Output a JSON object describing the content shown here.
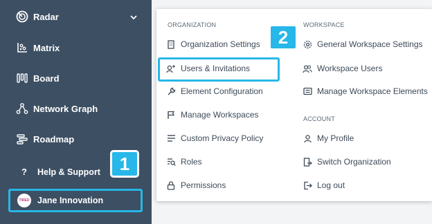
{
  "sidebar": {
    "items": [
      {
        "label": "Radar",
        "icon": "radar-icon"
      },
      {
        "label": "Matrix",
        "icon": "matrix-icon"
      },
      {
        "label": "Board",
        "icon": "board-icon"
      },
      {
        "label": "Network Graph",
        "icon": "network-graph-icon"
      },
      {
        "label": "Roadmap",
        "icon": "roadmap-icon"
      }
    ],
    "help_label": "Help & Support",
    "user_name": "Jane Innovation",
    "avatar_text": "TIRED"
  },
  "badges": {
    "one": "1",
    "two": "2"
  },
  "menu": {
    "organization_heading": "ORGANIZATION",
    "organization_items": [
      {
        "label": "Organization Settings",
        "icon": "building-icon"
      },
      {
        "label": "Users & Invitations",
        "icon": "user-plus-icon"
      },
      {
        "label": "Element Configuration",
        "icon": "wrench-icon"
      },
      {
        "label": "Manage Workspaces",
        "icon": "flag-icon"
      },
      {
        "label": "Custom Privacy Policy",
        "icon": "lines-icon"
      },
      {
        "label": "Roles",
        "icon": "roles-icon"
      },
      {
        "label": "Permissions",
        "icon": "lock-icon"
      }
    ],
    "workspace_heading": "WORKSPACE",
    "workspace_items": [
      {
        "label": "General Workspace Settings",
        "icon": "gear-icon"
      },
      {
        "label": "Workspace Users",
        "icon": "users-icon"
      },
      {
        "label": "Manage Workspace Elements",
        "icon": "list-box-icon"
      }
    ],
    "account_heading": "ACCOUNT",
    "account_items": [
      {
        "label": "My Profile",
        "icon": "user-icon"
      },
      {
        "label": "Switch Organization",
        "icon": "switch-icon"
      },
      {
        "label": "Log out",
        "icon": "logout-icon"
      }
    ]
  },
  "colors": {
    "sidebar": "#3d4f63",
    "accent": "#27b7e8",
    "menu_text": "#3e4a58"
  }
}
